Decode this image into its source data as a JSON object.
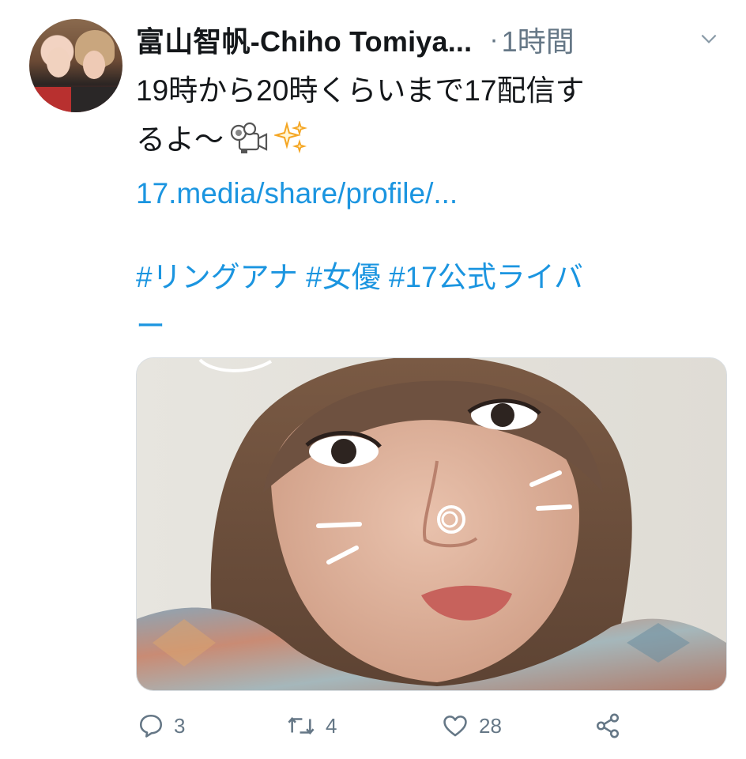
{
  "tweet": {
    "author": {
      "display_name": "富山智帆-Chiho Tomiya...",
      "avatar_icon": "avatar-photo"
    },
    "separator": "·",
    "time": "1時間",
    "text_line1": "19時から20時くらいまで17配信す",
    "text_line2": "るよ〜",
    "emoji": [
      "video-camera-icon",
      "sparkles-icon"
    ],
    "link": "17.media/share/profile/...",
    "hashtags_line1": "#リングアナ #女優 #17公式ライバ",
    "hashtags_line2": "ー",
    "media": {
      "type": "photo"
    },
    "actions": {
      "reply_count": "3",
      "retweet_count": "4",
      "like_count": "28"
    }
  },
  "colors": {
    "text": "#14171a",
    "muted": "#657786",
    "link": "#1b95e0",
    "sparkle": "#f5a623"
  }
}
